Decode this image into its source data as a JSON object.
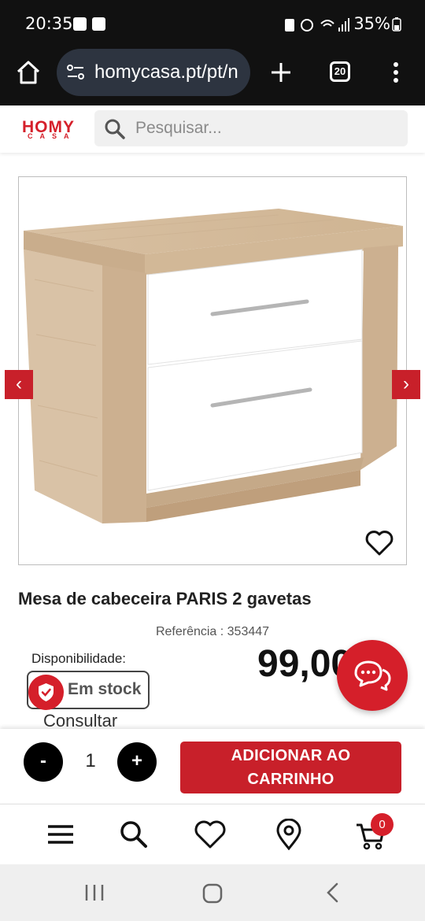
{
  "status_bar": {
    "time": "20:35",
    "battery": "35%"
  },
  "browser": {
    "url": "homycasa.pt/pt/n",
    "tab_count": "20"
  },
  "site": {
    "logo_main": "HOMY",
    "logo_sub": "CASA",
    "search_placeholder": "Pesquisar..."
  },
  "product": {
    "title": "Mesa de cabeceira PARIS 2 gavetas",
    "reference": "Referência : 353447",
    "availability_label": "Disponibilidade:",
    "stock_status": "Em stock",
    "consult_text": "Consultar",
    "price": "99,00 €"
  },
  "cart_bar": {
    "minus_label": "-",
    "quantity": "1",
    "plus_label": "+",
    "add_line1": "ADICIONAR AO",
    "add_line2": "CARRINHO"
  },
  "bottom_nav": {
    "cart_count": "0"
  },
  "colors": {
    "brand_red": "#d51f2a",
    "button_red": "#c8202a"
  }
}
